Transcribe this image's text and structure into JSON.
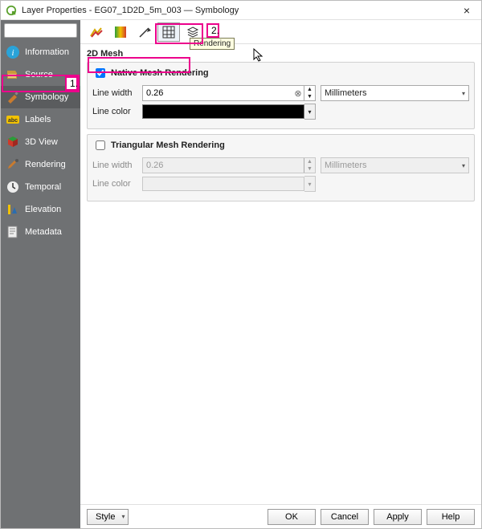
{
  "window": {
    "title": "Layer Properties - EG07_1D2D_5m_003 — Symbology",
    "close": "×"
  },
  "search": {
    "placeholder": ""
  },
  "sidebar": {
    "items": [
      {
        "label": "Information"
      },
      {
        "label": "Source"
      },
      {
        "label": "Symbology"
      },
      {
        "label": "Labels"
      },
      {
        "label": "3D View"
      },
      {
        "label": "Rendering"
      },
      {
        "label": "Temporal"
      },
      {
        "label": "Elevation"
      },
      {
        "label": "Metadata"
      }
    ]
  },
  "toolbar": {
    "tooltip": "Rendering"
  },
  "content": {
    "section_title": "2D Mesh",
    "native": {
      "checked": true,
      "label": "Native Mesh Rendering",
      "line_width_label": "Line width",
      "line_width_value": "0.26",
      "units": "Millimeters",
      "line_color_label": "Line color"
    },
    "triangular": {
      "checked": false,
      "label": "Triangular Mesh Rendering",
      "line_width_label": "Line width",
      "line_width_value": "0.26",
      "units": "Millimeters",
      "line_color_label": "Line color"
    }
  },
  "footer": {
    "style": "Style",
    "ok": "OK",
    "cancel": "Cancel",
    "apply": "Apply",
    "help": "Help"
  },
  "callouts": {
    "one": "1.",
    "two": "2."
  }
}
